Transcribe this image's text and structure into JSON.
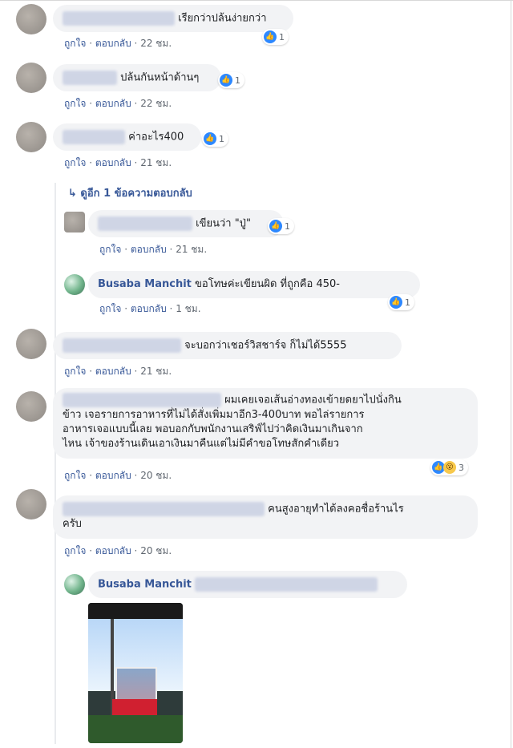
{
  "comments": [
    {
      "text": "เรียกว่าปล้นง่ายกว่า",
      "like_count": "1",
      "actions": {
        "like": "ถูกใจ",
        "reply": "ตอบกลับ",
        "time": "22 ชม."
      }
    },
    {
      "text": "ปล้นกันหน้าด้านๆ",
      "like_count": "1",
      "actions": {
        "like": "ถูกใจ",
        "reply": "ตอบกลับ",
        "time": "22 ชม."
      }
    },
    {
      "text": "ค่าอะไร400",
      "like_count": "1",
      "actions": {
        "like": "ถูกใจ",
        "reply": "ตอบกลับ",
        "time": "21 ชม."
      }
    },
    {
      "text": "จะบอกว่าเชอร์วิสชาร์จ ก็ไม่ได้5555",
      "actions": {
        "like": "ถูกใจ",
        "reply": "ตอบกลับ",
        "time": "21 ชม."
      }
    },
    {
      "text_lines": [
        "ผมเคยเจอเส้นอ่างทองเข้ายดยาไปนั่งกิน",
        "ข้าว เจอรายการอาหารที่ไม่ได้สั่งเพิ่มมาอีก3-400บาท พอไล่รายการ",
        "อาหารเจอแบบนี้เลย พอบอกกับพนักงานเสริฟ์ไปว่าคิดเงินมาเกินจาก",
        "ไหน เจ้าของร้านเดินเอาเงินมาคืนแต่ไม่มีคำขอโทษสักคำเดียว"
      ],
      "react_count": "3",
      "actions": {
        "like": "ถูกใจ",
        "reply": "ตอบกลับ",
        "time": "20 ชม."
      }
    },
    {
      "text_lines": [
        "คนสูงอายุทำได้ลงคอชื่อร้านไร",
        "ครับ"
      ],
      "actions": {
        "like": "ถูกใจ",
        "reply": "ตอบกลับ",
        "time": "20 ชม."
      }
    }
  ],
  "more_replies": "↳  ดูอีก 1 ข้อความตอบกลับ",
  "replies": [
    {
      "text": "เขียนว่า \"ปู่\"",
      "like_count": "1",
      "actions": {
        "like": "ถูกใจ",
        "reply": "ตอบกลับ",
        "time": "21 ชม."
      }
    },
    {
      "name": "Busaba Manchit",
      "text": "ขอโทษค่ะเขียนผิด ที่ถูกคือ 450-",
      "like_count": "1",
      "actions": {
        "like": "ถูกใจ",
        "reply": "ตอบกลับ",
        "time": "1 ชม."
      }
    },
    {
      "name": "Busaba Manchit"
    }
  ],
  "colors": {
    "link": "#385898",
    "bubble": "#f2f3f5",
    "meta": "#606770",
    "like": "#2d88ff"
  }
}
